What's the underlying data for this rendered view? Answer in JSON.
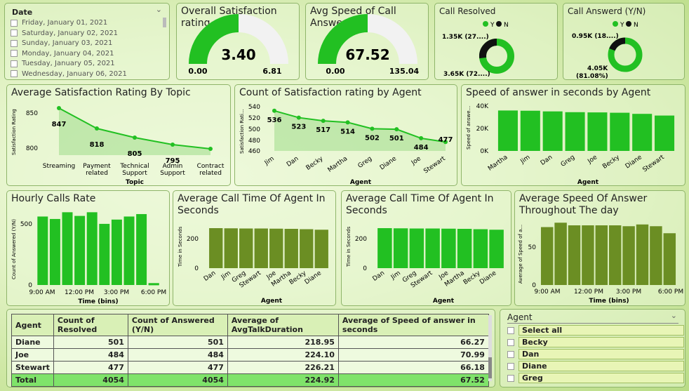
{
  "date_slicer": {
    "title": "Date",
    "items": [
      "Friday, January 01, 2021",
      "Saturday, January 02, 2021",
      "Sunday, January 03, 2021",
      "Monday, January 04, 2021",
      "Tuesday, January 05, 2021",
      "Wednesday, January 06, 2021"
    ]
  },
  "gauges": [
    {
      "title": "Overall Satisfaction rating",
      "value": "3.40",
      "min": "0.00",
      "max": "6.81",
      "fraction": 0.5
    },
    {
      "title": "Avg Speed of Call Answer",
      "value": "67.52",
      "min": "0.00",
      "max": "135.04",
      "fraction": 0.5
    }
  ],
  "donuts": [
    {
      "title": "Call Resolved",
      "legend_y": "Y",
      "legend_n": "N",
      "label_top": "1.35K (27....)",
      "label_bottom": "3.65K (72....)",
      "y_fraction": 0.73
    },
    {
      "title": "Call Answerd (Y/N)",
      "legend_y": "Y",
      "legend_n": "N",
      "label_top": "0.95K (18....)",
      "label_bottom": "4.05K",
      "label_bottom2": "(81.08%)",
      "y_fraction": 0.81
    }
  ],
  "colors": {
    "bright_green": "#22c022",
    "olive": "#6b8e23",
    "dark": "#111111",
    "table_total": "#7fe36a"
  },
  "chart_data": [
    {
      "type": "area",
      "title": "Average Satisfaction Rating By Topic",
      "xlabel": "Topic",
      "ylabel": "Satisfaction Rating",
      "categories": [
        "Streaming",
        "Payment related",
        "Technical Support",
        "Admin Support",
        "Contract related"
      ],
      "values": [
        847,
        818,
        805,
        795,
        789
      ],
      "data_labels": [
        "847",
        "818",
        "805",
        "795",
        ""
      ],
      "yticks": [
        "850",
        "800"
      ],
      "ylim": [
        780,
        860
      ]
    },
    {
      "type": "area",
      "title": "Count of Satisfaction rating by Agent",
      "xlabel": "Agent",
      "ylabel": "Satisfaction Rati...",
      "categories": [
        "Jim",
        "Dan",
        "Becky",
        "Martha",
        "Greg",
        "Diane",
        "Joe",
        "Stewart"
      ],
      "values": [
        536,
        523,
        517,
        514,
        502,
        501,
        484,
        477
      ],
      "yticks": [
        "540",
        "520",
        "500",
        "480",
        "460"
      ],
      "ylim": [
        460,
        545
      ]
    },
    {
      "type": "bar",
      "title": "Speed of answer in seconds by Agent",
      "xlabel": "Agent",
      "ylabel": "Speed of answe...",
      "categories": [
        "Martha",
        "Jim",
        "Dan",
        "Greg",
        "Joe",
        "Becky",
        "Diane",
        "Stewart"
      ],
      "values": [
        36000,
        35800,
        35200,
        34500,
        34300,
        34000,
        33000,
        31500
      ],
      "yticks": [
        "40K",
        "20K",
        "0K"
      ],
      "ylim": [
        0,
        40000
      ]
    },
    {
      "type": "bar",
      "title": "Hourly Calls Rate",
      "xlabel": "Time (bins)",
      "ylabel": "Count of Answered (Y/N)",
      "xticks": [
        "9:00 AM",
        "12:00 PM",
        "3:00 PM",
        "6:00 PM"
      ],
      "values": [
        560,
        540,
        595,
        565,
        595,
        500,
        535,
        560,
        580,
        15
      ],
      "yticks": [
        "500",
        "0"
      ],
      "ylim": [
        0,
        620
      ]
    },
    {
      "type": "bar",
      "title": "Average Call Time Of Agent In Seconds",
      "xlabel": "Agent",
      "ylabel": "Time in Seconds",
      "categories": [
        "Dan",
        "Jim",
        "Greg",
        "Stewart",
        "Joe",
        "Martha",
        "Becky",
        "Diane"
      ],
      "values": [
        228,
        227,
        226,
        226,
        225,
        224,
        222,
        219
      ],
      "yticks": [
        "200",
        "0"
      ],
      "ylim": [
        0,
        300
      ]
    },
    {
      "type": "bar",
      "title": "Average Call Time Of Agent In Seconds",
      "xlabel": "Agent",
      "ylabel": "Time in Seconds",
      "categories": [
        "Dan",
        "Jim",
        "Greg",
        "Stewart",
        "Joe",
        "Martha",
        "Becky",
        "Diane"
      ],
      "values": [
        228,
        227,
        226,
        226,
        225,
        224,
        222,
        219
      ],
      "yticks": [
        "200",
        "0"
      ],
      "ylim": [
        0,
        300
      ]
    },
    {
      "type": "bar",
      "title": "Average Speed Of Answer Throughout The day",
      "xlabel": "Time (bins)",
      "ylabel": "Average of Speed of a...",
      "xticks": [
        "9:00 AM",
        "12:00 PM",
        "3:00 PM",
        "6:00 PM"
      ],
      "values": [
        66,
        71,
        68,
        68,
        68,
        68,
        67,
        69,
        67,
        59
      ],
      "yticks": [
        "50",
        "0"
      ],
      "ylim": [
        0,
        80
      ]
    }
  ],
  "table": {
    "headers": [
      "Agent",
      "Count of Resolved",
      "Count of Answered (Y/N)",
      "Average of AvgTalkDuration",
      "Average of Speed of answer in seconds"
    ],
    "rows": [
      [
        "Diane",
        "501",
        "501",
        "218.95",
        "66.27"
      ],
      [
        "Joe",
        "484",
        "484",
        "224.10",
        "70.99"
      ],
      [
        "Stewart",
        "477",
        "477",
        "226.21",
        "66.18"
      ]
    ],
    "total": [
      "Total",
      "4054",
      "4054",
      "224.92",
      "67.52"
    ]
  },
  "agent_slicer": {
    "title": "Agent",
    "items": [
      "Select all",
      "Becky",
      "Dan",
      "Diane",
      "Greg"
    ]
  }
}
